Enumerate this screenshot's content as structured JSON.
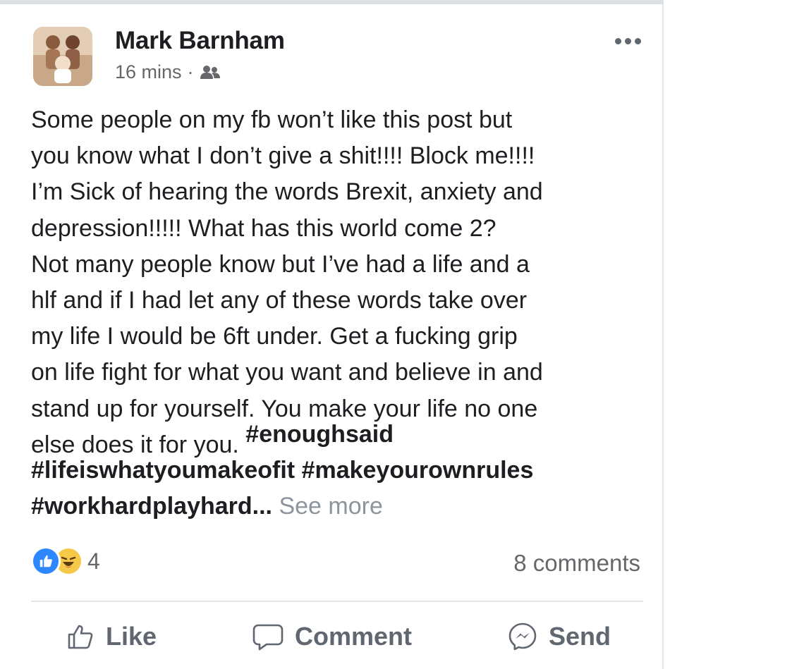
{
  "post": {
    "author": "Mark Barnham",
    "time": "16 mins",
    "separator": "·",
    "audience_icon": "friends-icon",
    "body": "Some people on my fb won’t like this post but\nyou know what I don’t give a shit!!!! Block me!!!!\nI’m Sick of hearing the words Brexit, anxiety and\ndepression!!!!! What has this world come 2?\nNot many people know but I’ve had a life and a\nhlf and if I had let any of these words take over\nmy life I would be 6ft under. Get a fucking grip\non life fight for what you want and believe in and\nstand up for yourself. You make your life no one\nelse does it for you.",
    "tags": [
      "#enoughsaid",
      "#lifeiswhatyoumakeofit",
      "#makeyourownrules",
      "#workhardplayhard..."
    ],
    "see_more": "See more"
  },
  "reactions": {
    "icons": [
      "like-reaction-icon",
      "haha-reaction-icon"
    ],
    "count": "4"
  },
  "comments": "8 comments",
  "actions": {
    "like": "Like",
    "comment": "Comment",
    "send": "Send"
  },
  "colors": {
    "text": "#1c1e21",
    "secondary": "#65676b",
    "see_more": "#8d949e",
    "like_blue": "#2d88ff",
    "haha_yellow": "#f7c948"
  }
}
